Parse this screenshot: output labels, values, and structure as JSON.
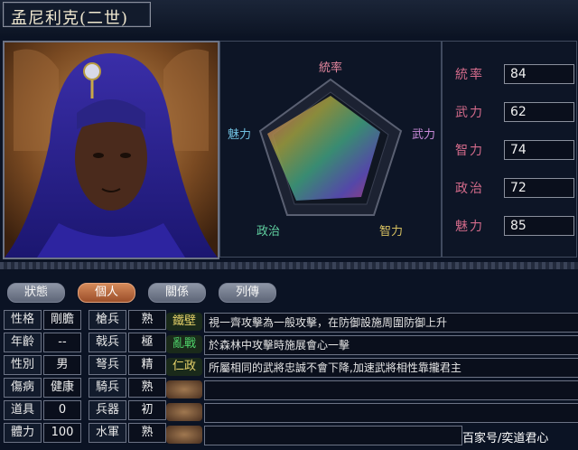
{
  "character": {
    "name": "孟尼利克(二世)"
  },
  "radar": {
    "labels": {
      "top": "統率",
      "right": "武力",
      "bottom_right": "智力",
      "bottom_left": "政治",
      "left": "魅力"
    }
  },
  "stats": [
    {
      "label": "統率",
      "value": "84"
    },
    {
      "label": "武力",
      "value": "62"
    },
    {
      "label": "智力",
      "value": "74"
    },
    {
      "label": "政治",
      "value": "72"
    },
    {
      "label": "魅力",
      "value": "85"
    }
  ],
  "tabs": [
    {
      "label": "狀態",
      "active": false
    },
    {
      "label": "個人",
      "active": true
    },
    {
      "label": "關係",
      "active": false
    },
    {
      "label": "列傳",
      "active": false
    }
  ],
  "attributes": {
    "left": [
      {
        "label": "性格",
        "value": "剛膽"
      },
      {
        "label": "年齡",
        "value": "--"
      },
      {
        "label": "性別",
        "value": "男"
      },
      {
        "label": "傷病",
        "value": "健康"
      },
      {
        "label": "道具",
        "value": "0"
      },
      {
        "label": "體力",
        "value": "100"
      }
    ],
    "right": [
      {
        "label": "槍兵",
        "value": "熟"
      },
      {
        "label": "戟兵",
        "value": "極"
      },
      {
        "label": "弩兵",
        "value": "精"
      },
      {
        "label": "騎兵",
        "value": "熟"
      },
      {
        "label": "兵器",
        "value": "初"
      },
      {
        "label": "水軍",
        "value": "熟"
      }
    ]
  },
  "skills": [
    {
      "name": "鐵壁",
      "color": "#e7d36a",
      "desc": "視一齊攻擊為一般攻擊，在防御設施周圍防御上升"
    },
    {
      "name": "亂戰",
      "color": "#4fd36a",
      "desc": "於森林中攻擊時施展會心一擊"
    },
    {
      "name": "仁政",
      "color": "#e7d36a",
      "desc": "所屬相同的武將忠誠不會下降,加速武將相性靠攏君主"
    },
    {
      "name": "",
      "color": "#a07850",
      "desc": ""
    },
    {
      "name": "",
      "color": "#a07850",
      "desc": ""
    },
    {
      "name": "",
      "color": "#a07850",
      "desc": ""
    }
  ],
  "watermark": "百家号/奕道君心",
  "colors": {
    "stat_label": "#d26a8a",
    "panel_bg": "#0d1526",
    "active_tab": "#c46e40"
  }
}
